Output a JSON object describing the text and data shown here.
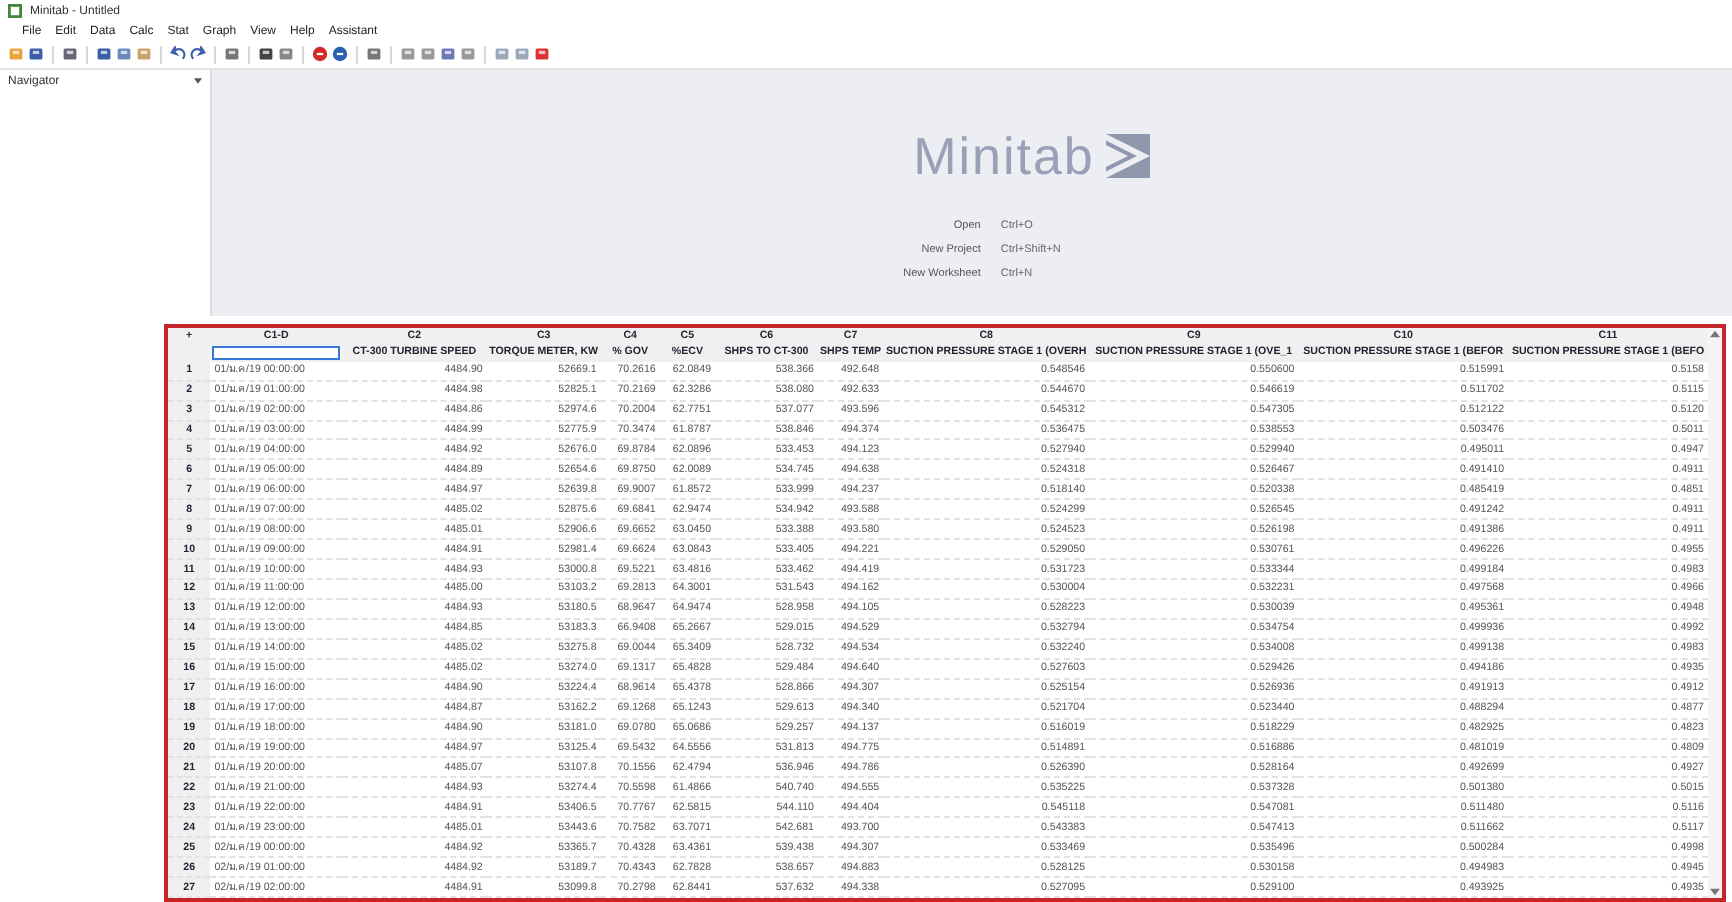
{
  "window": {
    "title": "Minitab - Untitled"
  },
  "menu": [
    "File",
    "Edit",
    "Data",
    "Calc",
    "Stat",
    "Graph",
    "View",
    "Help",
    "Assistant"
  ],
  "navigator": {
    "title": "Navigator"
  },
  "start_page": {
    "logo": "Minitab",
    "links": [
      {
        "label": "Open",
        "shortcut": "Ctrl+O"
      },
      {
        "label": "New Project",
        "shortcut": "Ctrl+Shift+N"
      },
      {
        "label": "New Worksheet",
        "shortcut": "Ctrl+N"
      }
    ]
  },
  "worksheet": {
    "corner": "+",
    "columns": [
      {
        "id": "C1-D"
      },
      {
        "id": "C2",
        "name": "CT-300 TURBINE SPEED"
      },
      {
        "id": "C3",
        "name": "TORQUE METER, KW"
      },
      {
        "id": "C4",
        "name": "% GOV"
      },
      {
        "id": "C5",
        "name": "%ECV"
      },
      {
        "id": "C6",
        "name": "SHPS TO CT-300"
      },
      {
        "id": "C7",
        "name": "SHPS TEMP"
      },
      {
        "id": "C8",
        "name": "SUCTION PRESSURE STAGE 1 (OVERH"
      },
      {
        "id": "C9",
        "name": "SUCTION PRESSURE STAGE 1 (OVE_1"
      },
      {
        "id": "C10",
        "name": "SUCTION PRESSURE STAGE 1 (BEFOR"
      },
      {
        "id": "C11",
        "name": "SUCTION PRESSURE STAGE 1 (BEFO"
      }
    ],
    "rows": [
      {
        "index": "1",
        "cells": [
          "01/ม.ค/19 00:00:00",
          "4484.90",
          "52669.1",
          "70.2616",
          "62.0849",
          "538.366",
          "492.648",
          "0.548546",
          "0.550600",
          "0.515991",
          "0.5158"
        ]
      },
      {
        "index": "2",
        "cells": [
          "01/ม.ค/19 01:00:00",
          "4484.98",
          "52825.1",
          "70.2169",
          "62.3286",
          "538.080",
          "492.633",
          "0.544670",
          "0.546619",
          "0.511702",
          "0.5115"
        ]
      },
      {
        "index": "3",
        "cells": [
          "01/ม.ค/19 02:00:00",
          "4484.86",
          "52974.6",
          "70.2004",
          "62.7751",
          "537.077",
          "493.596",
          "0.545312",
          "0.547305",
          "0.512122",
          "0.5120"
        ]
      },
      {
        "index": "4",
        "cells": [
          "01/ม.ค/19 03:00:00",
          "4484.99",
          "52775.9",
          "70.3474",
          "61.8787",
          "538.846",
          "494.374",
          "0.536475",
          "0.538553",
          "0.503476",
          "0.5011"
        ]
      },
      {
        "index": "5",
        "cells": [
          "01/ม.ค/19 04:00:00",
          "4484.92",
          "52676.0",
          "69.8784",
          "62.0896",
          "533.453",
          "494.123",
          "0.527940",
          "0.529940",
          "0.495011",
          "0.4947"
        ]
      },
      {
        "index": "6",
        "cells": [
          "01/ม.ค/19 05:00:00",
          "4484.89",
          "52654.6",
          "69.8750",
          "62.0089",
          "534.745",
          "494.638",
          "0.524318",
          "0.526467",
          "0.491410",
          "0.4911"
        ]
      },
      {
        "index": "7",
        "cells": [
          "01/ม.ค/19 06:00:00",
          "4484.97",
          "52639.8",
          "69.9007",
          "61.8572",
          "533.999",
          "494.237",
          "0.518140",
          "0.520338",
          "0.485419",
          "0.4851"
        ]
      },
      {
        "index": "8",
        "cells": [
          "01/ม.ค/19 07:00:00",
          "4485.02",
          "52875.6",
          "69.6841",
          "62.9474",
          "534.942",
          "493.588",
          "0.524299",
          "0.526545",
          "0.491242",
          "0.4911"
        ]
      },
      {
        "index": "9",
        "cells": [
          "01/ม.ค/19 08:00:00",
          "4485.01",
          "52906.6",
          "69.6652",
          "63.0450",
          "533.388",
          "493.580",
          "0.524523",
          "0.526198",
          "0.491386",
          "0.4911"
        ]
      },
      {
        "index": "10",
        "cells": [
          "01/ม.ค/19 09:00:00",
          "4484.91",
          "52981.4",
          "69.6624",
          "63.0843",
          "533.405",
          "494.221",
          "0.529050",
          "0.530761",
          "0.496226",
          "0.4955"
        ]
      },
      {
        "index": "11",
        "cells": [
          "01/ม.ค/19 10:00:00",
          "4484.93",
          "53000.8",
          "69.5221",
          "63.4816",
          "533.462",
          "494.419",
          "0.531723",
          "0.533344",
          "0.499184",
          "0.4983"
        ]
      },
      {
        "index": "12",
        "cells": [
          "01/ม.ค/19 11:00:00",
          "4485.00",
          "53103.2",
          "69.2813",
          "64.3001",
          "531.543",
          "494.162",
          "0.530004",
          "0.532231",
          "0.497568",
          "0.4966"
        ]
      },
      {
        "index": "13",
        "cells": [
          "01/ม.ค/19 12:00:00",
          "4484.93",
          "53180.5",
          "68.9647",
          "64.9474",
          "528.958",
          "494.105",
          "0.528223",
          "0.530039",
          "0.495361",
          "0.4948"
        ]
      },
      {
        "index": "14",
        "cells": [
          "01/ม.ค/19 13:00:00",
          "4484.85",
          "53183.3",
          "66.9408",
          "65.2667",
          "529.015",
          "494.529",
          "0.532794",
          "0.534754",
          "0.499936",
          "0.4992"
        ]
      },
      {
        "index": "15",
        "cells": [
          "01/ม.ค/19 14:00:00",
          "4485.02",
          "53275.8",
          "69.0044",
          "65.3409",
          "528.732",
          "494.534",
          "0.532240",
          "0.534008",
          "0.499138",
          "0.4983"
        ]
      },
      {
        "index": "16",
        "cells": [
          "01/ม.ค/19 15:00:00",
          "4485.02",
          "53274.0",
          "69.1317",
          "65.4828",
          "529.484",
          "494.640",
          "0.527603",
          "0.529426",
          "0.494186",
          "0.4935"
        ]
      },
      {
        "index": "17",
        "cells": [
          "01/ม.ค/19 16:00:00",
          "4484.90",
          "53224.4",
          "68.9614",
          "65.4378",
          "528.866",
          "494.307",
          "0.525154",
          "0.526936",
          "0.491913",
          "0.4912"
        ]
      },
      {
        "index": "18",
        "cells": [
          "01/ม.ค/19 17:00:00",
          "4484.87",
          "53162.2",
          "69.1268",
          "65.1243",
          "529.613",
          "494.340",
          "0.521704",
          "0.523440",
          "0.488294",
          "0.4877"
        ]
      },
      {
        "index": "19",
        "cells": [
          "01/ม.ค/19 18:00:00",
          "4484.90",
          "53181.0",
          "69.0780",
          "65.0686",
          "529.257",
          "494.137",
          "0.516019",
          "0.518229",
          "0.482925",
          "0.4823"
        ]
      },
      {
        "index": "20",
        "cells": [
          "01/ม.ค/19 19:00:00",
          "4484.97",
          "53125.4",
          "69.5432",
          "64.5556",
          "531.813",
          "494.775",
          "0.514891",
          "0.516886",
          "0.481019",
          "0.4809"
        ]
      },
      {
        "index": "21",
        "cells": [
          "01/ม.ค/19 20:00:00",
          "4485.07",
          "53107.8",
          "70.1556",
          "62.4794",
          "536.946",
          "494.786",
          "0.526390",
          "0.528164",
          "0.492699",
          "0.4927"
        ]
      },
      {
        "index": "22",
        "cells": [
          "01/ม.ค/19 21:00:00",
          "4484.93",
          "53274.4",
          "70.5598",
          "61.4866",
          "540.740",
          "494.555",
          "0.535225",
          "0.537328",
          "0.501380",
          "0.5015"
        ]
      },
      {
        "index": "23",
        "cells": [
          "01/ม.ค/19 22:00:00",
          "4484.91",
          "53406.5",
          "70.7767",
          "62.5815",
          "544.110",
          "494.404",
          "0.545118",
          "0.547081",
          "0.511480",
          "0.5116"
        ]
      },
      {
        "index": "24",
        "cells": [
          "01/ม.ค/19 23:00:00",
          "4485.01",
          "53443.6",
          "70.7582",
          "63.7071",
          "542.681",
          "493.700",
          "0.543383",
          "0.547413",
          "0.511662",
          "0.5117"
        ]
      },
      {
        "index": "25",
        "cells": [
          "02/ม.ค/19 00:00:00",
          "4484.92",
          "53365.7",
          "70.4328",
          "63.4361",
          "539.438",
          "494.307",
          "0.533469",
          "0.535496",
          "0.500284",
          "0.4998"
        ]
      },
      {
        "index": "26",
        "cells": [
          "02/ม.ค/19 01:00:00",
          "4484.92",
          "53189.7",
          "70.4343",
          "62.7828",
          "538.657",
          "494.883",
          "0.528125",
          "0.530158",
          "0.494983",
          "0.4945"
        ]
      },
      {
        "index": "27",
        "cells": [
          "02/ม.ค/19 02:00:00",
          "4484.91",
          "53099.8",
          "70.2798",
          "62.8441",
          "537.632",
          "494.338",
          "0.527095",
          "0.529100",
          "0.493925",
          "0.4935"
        ]
      }
    ]
  }
}
